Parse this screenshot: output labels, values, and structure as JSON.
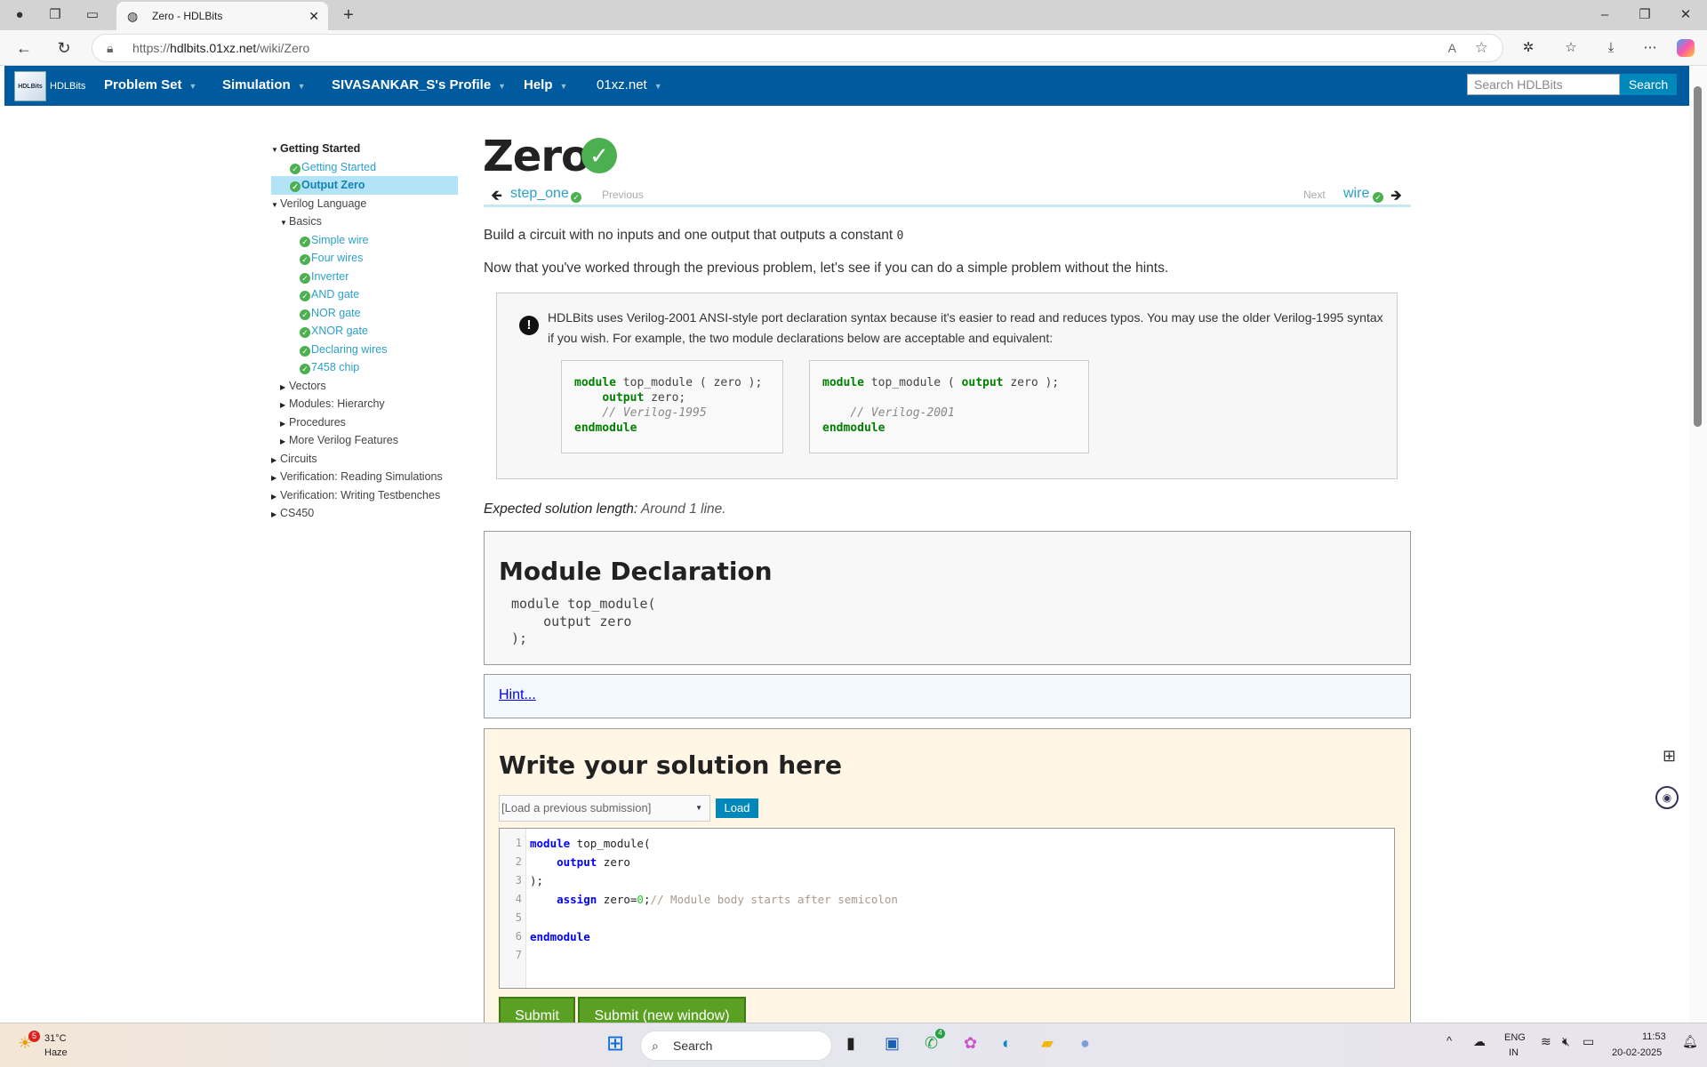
{
  "browser": {
    "tab_title": "Zero - HDLBits",
    "url_prefix": "https://",
    "url_host": "hdlbits.01xz.net",
    "url_path": "/wiki/Zero"
  },
  "nav": {
    "logo_text": "HDLBits",
    "items": [
      "Problem Set",
      "Simulation",
      "SIVASANKAR_S's Profile",
      "Help",
      "01xz.net"
    ],
    "search_placeholder": "Search HDLBits",
    "search_button": "Search"
  },
  "sidebar": {
    "items": [
      {
        "label": "Getting Started",
        "type": "section-open"
      },
      {
        "label": "Getting Started",
        "type": "done"
      },
      {
        "label": "Output Zero",
        "type": "done-selected"
      },
      {
        "label": "Verilog Language",
        "type": "section-open"
      },
      {
        "label": "Basics",
        "type": "subsection-open"
      },
      {
        "label": "Simple wire",
        "type": "done"
      },
      {
        "label": "Four wires",
        "type": "done"
      },
      {
        "label": "Inverter",
        "type": "done"
      },
      {
        "label": "AND gate",
        "type": "done"
      },
      {
        "label": "NOR gate",
        "type": "done"
      },
      {
        "label": "XNOR gate",
        "type": "done"
      },
      {
        "label": "Declaring wires",
        "type": "done"
      },
      {
        "label": "7458 chip",
        "type": "done"
      },
      {
        "label": "Vectors",
        "type": "subsection-closed"
      },
      {
        "label": "Modules: Hierarchy",
        "type": "subsection-closed"
      },
      {
        "label": "Procedures",
        "type": "subsection-closed"
      },
      {
        "label": "More Verilog Features",
        "type": "subsection-closed"
      },
      {
        "label": "Circuits",
        "type": "section-closed"
      },
      {
        "label": "Verification: Reading Simulations",
        "type": "section-closed"
      },
      {
        "label": "Verification: Writing Testbenches",
        "type": "section-closed"
      },
      {
        "label": "CS450",
        "type": "section-closed"
      }
    ]
  },
  "page": {
    "title": "Zero",
    "prev_link": "step_one",
    "prev_label": "Previous",
    "next_label": "Next",
    "next_link": "wire",
    "para1": "Build a circuit with no inputs and one output that outputs a constant ",
    "para1_code": "0",
    "para2": "Now that you've worked through the previous problem, let's see if you can do a simple problem without the hints.",
    "note": "HDLBits uses Verilog-2001 ANSI-style port declaration syntax because it's easier to read and reduces typos. You may use the older Verilog-1995 syntax if you wish. For example, the two module declarations below are acceptable and equivalent:",
    "code1995": {
      "l1a": "module",
      "l1b": " top_module ( zero );",
      "l2a": "output",
      "l2b": " zero;",
      "l3": "// Verilog-1995",
      "l4": "endmodule"
    },
    "code2001": {
      "l1a": "module",
      "l1b": " top_module ( ",
      "l1c": "output",
      "l1d": " zero );",
      "l3": "// Verilog-2001",
      "l4": "endmodule"
    },
    "expected_label": "Expected solution length:",
    "expected_value": " Around 1 line.",
    "decl_title": "Module Declaration",
    "decl_code": "module top_module(\n    output zero\n);",
    "hint": "Hint...",
    "solution_title": "Write your solution here",
    "select_value": "[Load a previous submission]",
    "load_button": "Load",
    "line_numbers": "1\n2\n3\n4\n5\n6\n7",
    "editor": {
      "l1a": "module",
      "l1b": " top_module(",
      "l2a": "output",
      "l2b": " zero",
      "l3": ");",
      "l4a": "assign",
      "l4b": " zero=",
      "l4c": "0",
      "l4d": ";",
      "l4e": "// Module body starts after semicolon",
      "l6": "endmodule"
    },
    "submit": "Submit",
    "submit_new": "Submit (new window)"
  },
  "taskbar": {
    "weather_temp": "31°C",
    "weather_desc": "Haze",
    "weather_badge": "5",
    "search": "Search",
    "whatsapp_badge": "4",
    "lang1": "ENG",
    "lang2": "IN",
    "time": "11:53",
    "date": "20-02-2025"
  },
  "colors": {
    "nav": "#005a9e",
    "accent": "#0088bb",
    "done": "#4caf50",
    "submit": "#5aa022",
    "solution_bg": "#fff6e6"
  }
}
